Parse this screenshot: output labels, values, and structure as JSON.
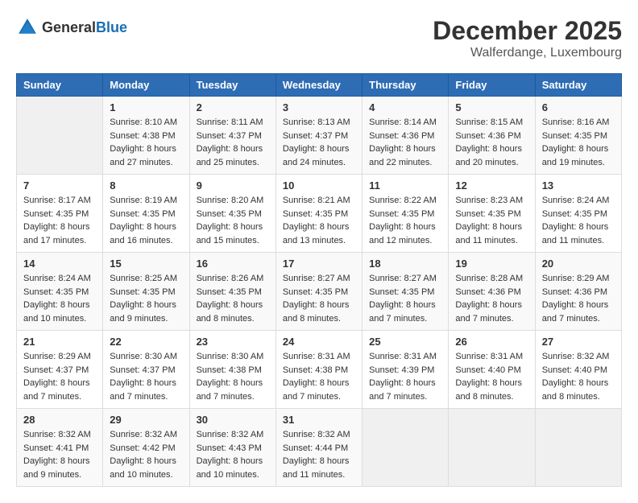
{
  "logo": {
    "general": "General",
    "blue": "Blue"
  },
  "title": {
    "month": "December 2025",
    "location": "Walferdange, Luxembourg"
  },
  "headers": [
    "Sunday",
    "Monday",
    "Tuesday",
    "Wednesday",
    "Thursday",
    "Friday",
    "Saturday"
  ],
  "weeks": [
    [
      {
        "day": "",
        "sunrise": "",
        "sunset": "",
        "daylight": ""
      },
      {
        "day": "1",
        "sunrise": "Sunrise: 8:10 AM",
        "sunset": "Sunset: 4:38 PM",
        "daylight": "Daylight: 8 hours and 27 minutes."
      },
      {
        "day": "2",
        "sunrise": "Sunrise: 8:11 AM",
        "sunset": "Sunset: 4:37 PM",
        "daylight": "Daylight: 8 hours and 25 minutes."
      },
      {
        "day": "3",
        "sunrise": "Sunrise: 8:13 AM",
        "sunset": "Sunset: 4:37 PM",
        "daylight": "Daylight: 8 hours and 24 minutes."
      },
      {
        "day": "4",
        "sunrise": "Sunrise: 8:14 AM",
        "sunset": "Sunset: 4:36 PM",
        "daylight": "Daylight: 8 hours and 22 minutes."
      },
      {
        "day": "5",
        "sunrise": "Sunrise: 8:15 AM",
        "sunset": "Sunset: 4:36 PM",
        "daylight": "Daylight: 8 hours and 20 minutes."
      },
      {
        "day": "6",
        "sunrise": "Sunrise: 8:16 AM",
        "sunset": "Sunset: 4:35 PM",
        "daylight": "Daylight: 8 hours and 19 minutes."
      }
    ],
    [
      {
        "day": "7",
        "sunrise": "Sunrise: 8:17 AM",
        "sunset": "Sunset: 4:35 PM",
        "daylight": "Daylight: 8 hours and 17 minutes."
      },
      {
        "day": "8",
        "sunrise": "Sunrise: 8:19 AM",
        "sunset": "Sunset: 4:35 PM",
        "daylight": "Daylight: 8 hours and 16 minutes."
      },
      {
        "day": "9",
        "sunrise": "Sunrise: 8:20 AM",
        "sunset": "Sunset: 4:35 PM",
        "daylight": "Daylight: 8 hours and 15 minutes."
      },
      {
        "day": "10",
        "sunrise": "Sunrise: 8:21 AM",
        "sunset": "Sunset: 4:35 PM",
        "daylight": "Daylight: 8 hours and 13 minutes."
      },
      {
        "day": "11",
        "sunrise": "Sunrise: 8:22 AM",
        "sunset": "Sunset: 4:35 PM",
        "daylight": "Daylight: 8 hours and 12 minutes."
      },
      {
        "day": "12",
        "sunrise": "Sunrise: 8:23 AM",
        "sunset": "Sunset: 4:35 PM",
        "daylight": "Daylight: 8 hours and 11 minutes."
      },
      {
        "day": "13",
        "sunrise": "Sunrise: 8:24 AM",
        "sunset": "Sunset: 4:35 PM",
        "daylight": "Daylight: 8 hours and 11 minutes."
      }
    ],
    [
      {
        "day": "14",
        "sunrise": "Sunrise: 8:24 AM",
        "sunset": "Sunset: 4:35 PM",
        "daylight": "Daylight: 8 hours and 10 minutes."
      },
      {
        "day": "15",
        "sunrise": "Sunrise: 8:25 AM",
        "sunset": "Sunset: 4:35 PM",
        "daylight": "Daylight: 8 hours and 9 minutes."
      },
      {
        "day": "16",
        "sunrise": "Sunrise: 8:26 AM",
        "sunset": "Sunset: 4:35 PM",
        "daylight": "Daylight: 8 hours and 8 minutes."
      },
      {
        "day": "17",
        "sunrise": "Sunrise: 8:27 AM",
        "sunset": "Sunset: 4:35 PM",
        "daylight": "Daylight: 8 hours and 8 minutes."
      },
      {
        "day": "18",
        "sunrise": "Sunrise: 8:27 AM",
        "sunset": "Sunset: 4:35 PM",
        "daylight": "Daylight: 8 hours and 7 minutes."
      },
      {
        "day": "19",
        "sunrise": "Sunrise: 8:28 AM",
        "sunset": "Sunset: 4:36 PM",
        "daylight": "Daylight: 8 hours and 7 minutes."
      },
      {
        "day": "20",
        "sunrise": "Sunrise: 8:29 AM",
        "sunset": "Sunset: 4:36 PM",
        "daylight": "Daylight: 8 hours and 7 minutes."
      }
    ],
    [
      {
        "day": "21",
        "sunrise": "Sunrise: 8:29 AM",
        "sunset": "Sunset: 4:37 PM",
        "daylight": "Daylight: 8 hours and 7 minutes."
      },
      {
        "day": "22",
        "sunrise": "Sunrise: 8:30 AM",
        "sunset": "Sunset: 4:37 PM",
        "daylight": "Daylight: 8 hours and 7 minutes."
      },
      {
        "day": "23",
        "sunrise": "Sunrise: 8:30 AM",
        "sunset": "Sunset: 4:38 PM",
        "daylight": "Daylight: 8 hours and 7 minutes."
      },
      {
        "day": "24",
        "sunrise": "Sunrise: 8:31 AM",
        "sunset": "Sunset: 4:38 PM",
        "daylight": "Daylight: 8 hours and 7 minutes."
      },
      {
        "day": "25",
        "sunrise": "Sunrise: 8:31 AM",
        "sunset": "Sunset: 4:39 PM",
        "daylight": "Daylight: 8 hours and 7 minutes."
      },
      {
        "day": "26",
        "sunrise": "Sunrise: 8:31 AM",
        "sunset": "Sunset: 4:40 PM",
        "daylight": "Daylight: 8 hours and 8 minutes."
      },
      {
        "day": "27",
        "sunrise": "Sunrise: 8:32 AM",
        "sunset": "Sunset: 4:40 PM",
        "daylight": "Daylight: 8 hours and 8 minutes."
      }
    ],
    [
      {
        "day": "28",
        "sunrise": "Sunrise: 8:32 AM",
        "sunset": "Sunset: 4:41 PM",
        "daylight": "Daylight: 8 hours and 9 minutes."
      },
      {
        "day": "29",
        "sunrise": "Sunrise: 8:32 AM",
        "sunset": "Sunset: 4:42 PM",
        "daylight": "Daylight: 8 hours and 10 minutes."
      },
      {
        "day": "30",
        "sunrise": "Sunrise: 8:32 AM",
        "sunset": "Sunset: 4:43 PM",
        "daylight": "Daylight: 8 hours and 10 minutes."
      },
      {
        "day": "31",
        "sunrise": "Sunrise: 8:32 AM",
        "sunset": "Sunset: 4:44 PM",
        "daylight": "Daylight: 8 hours and 11 minutes."
      },
      {
        "day": "",
        "sunrise": "",
        "sunset": "",
        "daylight": ""
      },
      {
        "day": "",
        "sunrise": "",
        "sunset": "",
        "daylight": ""
      },
      {
        "day": "",
        "sunrise": "",
        "sunset": "",
        "daylight": ""
      }
    ]
  ]
}
